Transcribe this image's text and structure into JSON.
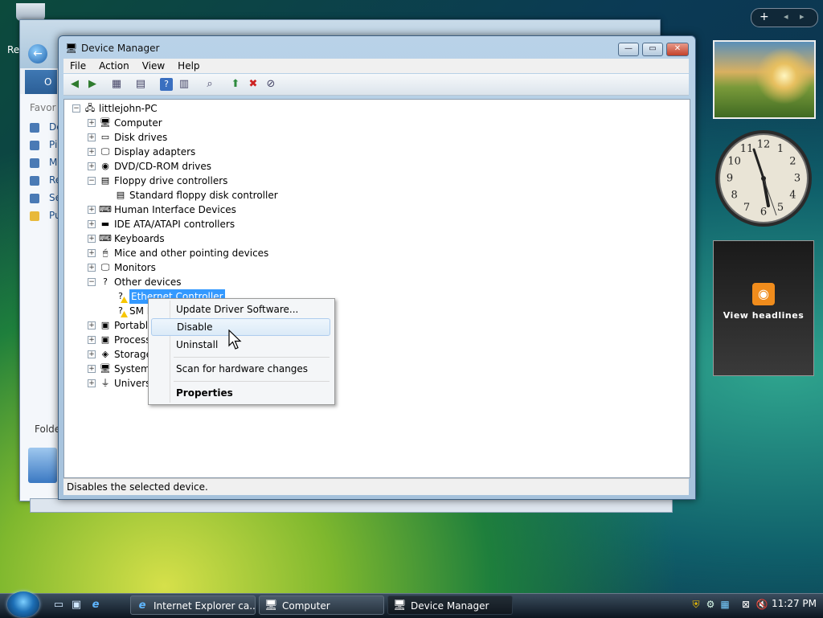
{
  "background_window": {
    "back_label": "Re",
    "nav_label": "O",
    "favorites_label": "Favor",
    "folders_label": "Folde",
    "side_items": [
      "De",
      "Pi",
      "M",
      "Re",
      "Se",
      "Pu"
    ]
  },
  "device_manager": {
    "title": "Device Manager",
    "caption_buttons": {
      "minimize": "—",
      "maximize": "▭",
      "close": "✕"
    },
    "menu": [
      "File",
      "Action",
      "View",
      "Help"
    ],
    "tree": [
      {
        "label": "littlejohn-PC",
        "level": 0,
        "expander": "−",
        "icon": "computer-network-icon",
        "glyph": "🖧"
      },
      {
        "label": "Computer",
        "level": 1,
        "expander": "+",
        "icon": "computer-icon",
        "glyph": "🖥"
      },
      {
        "label": "Disk drives",
        "level": 1,
        "expander": "+",
        "icon": "disk-drive-icon",
        "glyph": "▭"
      },
      {
        "label": "Display adapters",
        "level": 1,
        "expander": "+",
        "icon": "display-adapter-icon",
        "glyph": "🖵"
      },
      {
        "label": "DVD/CD-ROM drives",
        "level": 1,
        "expander": "+",
        "icon": "dvd-drive-icon",
        "glyph": "◉"
      },
      {
        "label": "Floppy drive controllers",
        "level": 1,
        "expander": "−",
        "icon": "floppy-controller-icon",
        "glyph": "▤"
      },
      {
        "label": "Standard floppy disk controller",
        "level": 2,
        "expander": "",
        "icon": "floppy-controller-icon",
        "glyph": "▤"
      },
      {
        "label": "Human Interface Devices",
        "level": 1,
        "expander": "+",
        "icon": "hid-icon",
        "glyph": "⌨"
      },
      {
        "label": "IDE ATA/ATAPI controllers",
        "level": 1,
        "expander": "+",
        "icon": "ide-controller-icon",
        "glyph": "▬"
      },
      {
        "label": "Keyboards",
        "level": 1,
        "expander": "+",
        "icon": "keyboard-icon",
        "glyph": "⌨"
      },
      {
        "label": "Mice and other pointing devices",
        "level": 1,
        "expander": "+",
        "icon": "mouse-icon",
        "glyph": "🖱"
      },
      {
        "label": "Monitors",
        "level": 1,
        "expander": "+",
        "icon": "monitor-icon",
        "glyph": "🖵"
      },
      {
        "label": "Other devices",
        "level": 1,
        "expander": "−",
        "icon": "unknown-device-icon",
        "glyph": "?"
      },
      {
        "label": "Ethernet Controller",
        "level": 2,
        "expander": "",
        "icon": "warning-device-icon",
        "glyph": "?",
        "selected": true,
        "warning": true
      },
      {
        "label": "SM B",
        "level": 2,
        "expander": "",
        "icon": "warning-device-icon",
        "glyph": "?",
        "warning": true
      },
      {
        "label": "Portable Devices",
        "level": 1,
        "expander": "+",
        "icon": "portable-device-icon",
        "glyph": "▣"
      },
      {
        "label": "Processors",
        "level": 1,
        "expander": "+",
        "icon": "processor-icon",
        "glyph": "▣"
      },
      {
        "label": "Storage controllers",
        "level": 1,
        "expander": "+",
        "icon": "storage-controller-icon",
        "glyph": "◈"
      },
      {
        "label": "System devices",
        "level": 1,
        "expander": "+",
        "icon": "system-device-icon",
        "glyph": "🖥"
      },
      {
        "label": "Universal Serial Bus controllers",
        "level": 1,
        "expander": "+",
        "icon": "usb-icon",
        "glyph": "⏚"
      }
    ],
    "status": "Disables the selected device."
  },
  "context_menu": {
    "items": [
      {
        "label": "Update Driver Software...",
        "bold": false,
        "hover": false
      },
      {
        "label": "Disable",
        "bold": false,
        "hover": true
      },
      {
        "label": "Uninstall",
        "bold": false,
        "hover": false
      },
      {
        "label": "Scan for hardware changes",
        "bold": false,
        "hover": false
      },
      {
        "label": "Properties",
        "bold": true,
        "hover": false
      }
    ]
  },
  "gadgets": {
    "clock_numbers": [
      "12",
      "1",
      "2",
      "3",
      "4",
      "5",
      "6",
      "7",
      "8",
      "9",
      "10",
      "11"
    ],
    "feed_label": "View headlines",
    "top_controls": {
      "add": "+",
      "prev": "◂",
      "next": "▸"
    }
  },
  "taskbar": {
    "tasks": [
      {
        "label": "Internet Explorer ca...",
        "icon": "ie-icon",
        "glyph": "e",
        "active": false
      },
      {
        "label": "Computer",
        "icon": "computer-icon",
        "glyph": "🖥",
        "active": false
      },
      {
        "label": "Device Manager",
        "icon": "device-manager-icon",
        "glyph": "🖥",
        "active": true
      }
    ],
    "clock": "11:27 PM"
  }
}
